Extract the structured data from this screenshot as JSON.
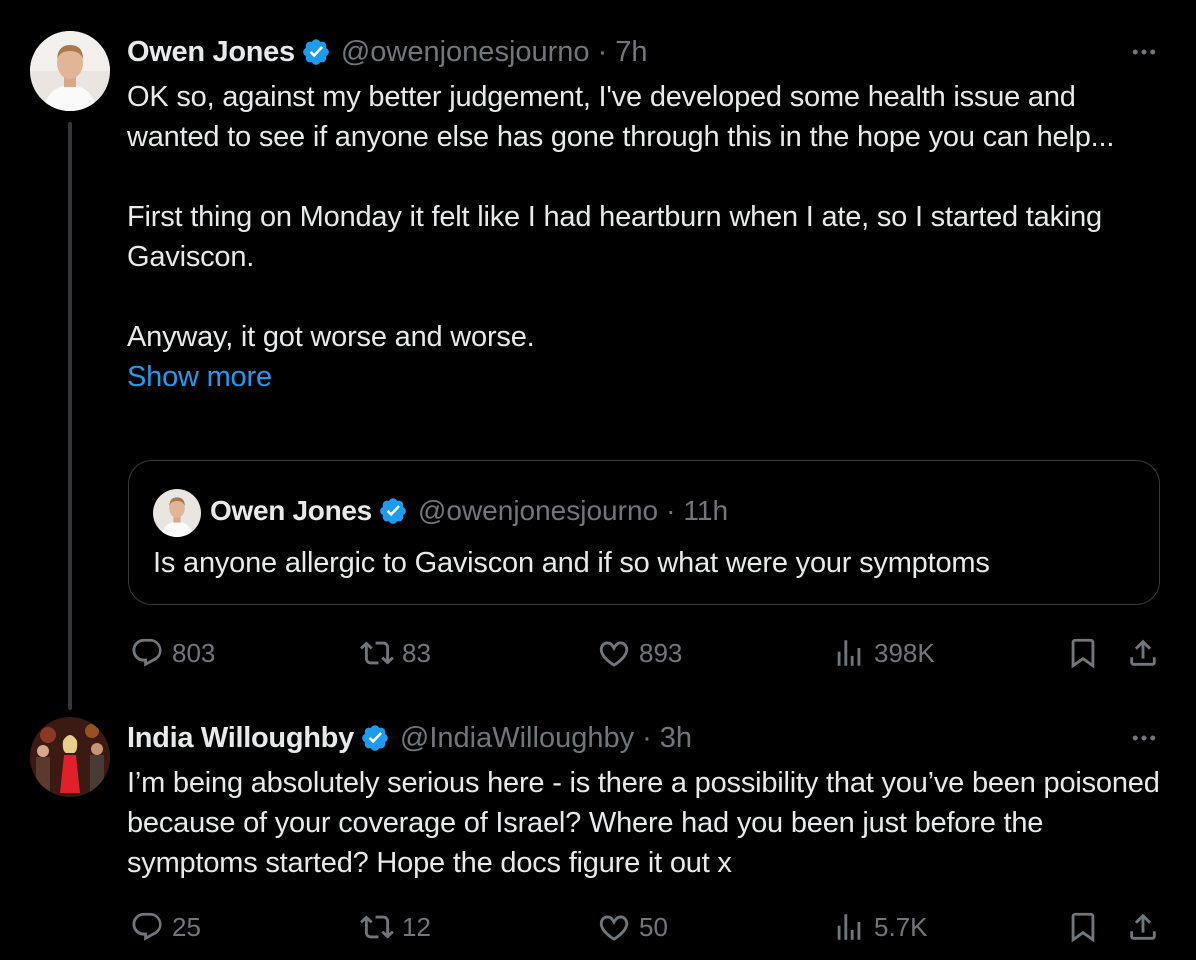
{
  "tweets": [
    {
      "author": "Owen Jones",
      "handle": "@owenjonesjourno",
      "separator": "·",
      "time": "7h",
      "more_icon": "more-horizontal-icon",
      "verified_color": "#1d9bf0",
      "paragraphs": [
        "OK so, against my better judgement, I've developed some health issue and wanted to see if anyone else has gone through this in the hope you can help...",
        "First thing on Monday it felt like I had heartburn when I ate, so I started taking Gaviscon.",
        "Anyway, it got worse and worse."
      ],
      "show_more": "Show more",
      "quote": {
        "author": "Owen Jones",
        "handle": "@owenjonesjourno",
        "separator": "·",
        "time": "11h",
        "text": "Is anyone allergic to Gaviscon and if so what were your symptoms"
      },
      "stats": {
        "replies": "803",
        "reposts": "83",
        "likes": "893",
        "views": "398K"
      }
    },
    {
      "author": "India Willoughby",
      "handle": "@IndiaWilloughby",
      "separator": "·",
      "time": "3h",
      "paragraphs": [
        "I’m being absolutely serious here - is there a possibility that you’ve been poisoned because of your coverage of Israel? Where had you been just before the symptoms started? Hope the docs figure it out x"
      ],
      "stats": {
        "replies": "25",
        "reposts": "12",
        "likes": "50",
        "views": "5.7K"
      }
    }
  ],
  "colors": {
    "accent": "#1d9bf0",
    "muted": "#71767b",
    "text": "#e7e9ea",
    "background": "#000000"
  }
}
